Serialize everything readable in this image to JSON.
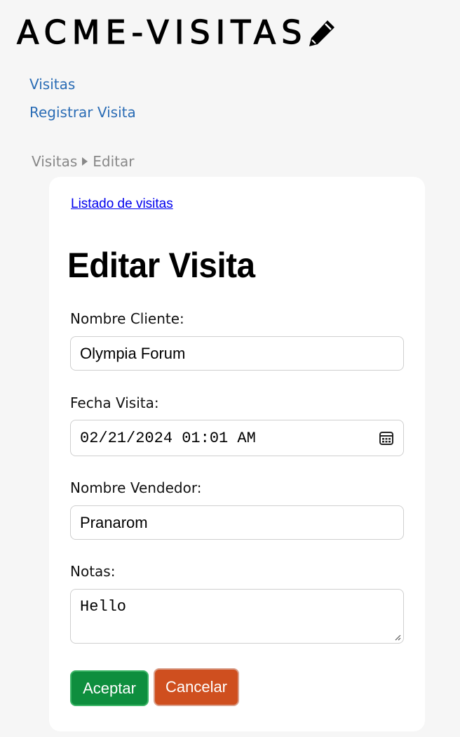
{
  "app": {
    "logo_text": "ACME-VISITAS",
    "logo_icon": "pencil-icon"
  },
  "nav": {
    "items": [
      "Visitas",
      "Registrar Visita"
    ]
  },
  "breadcrumb": {
    "items": [
      "Visitas",
      "Editar"
    ],
    "separator_icon": "caret-right-icon"
  },
  "card": {
    "back_link": "Listado de visitas",
    "title": "Editar Visita"
  },
  "form": {
    "cliente": {
      "label": "Nombre Cliente:",
      "value": "Olympia Forum"
    },
    "fecha": {
      "label": "Fecha Visita:",
      "value": "02/21/2024 01:01 AM",
      "icon": "calendar-icon"
    },
    "vendedor": {
      "label": "Nombre Vendedor:",
      "value": "Pranarom"
    },
    "notas": {
      "label": "Notas:",
      "value": "Hello"
    }
  },
  "buttons": {
    "accept": "Aceptar",
    "cancel": "Cancelar"
  },
  "colors": {
    "link": "#2a6cb5",
    "accept": "#0e8e3e",
    "cancel": "#cf4f1f",
    "background": "#f6f6f6"
  }
}
